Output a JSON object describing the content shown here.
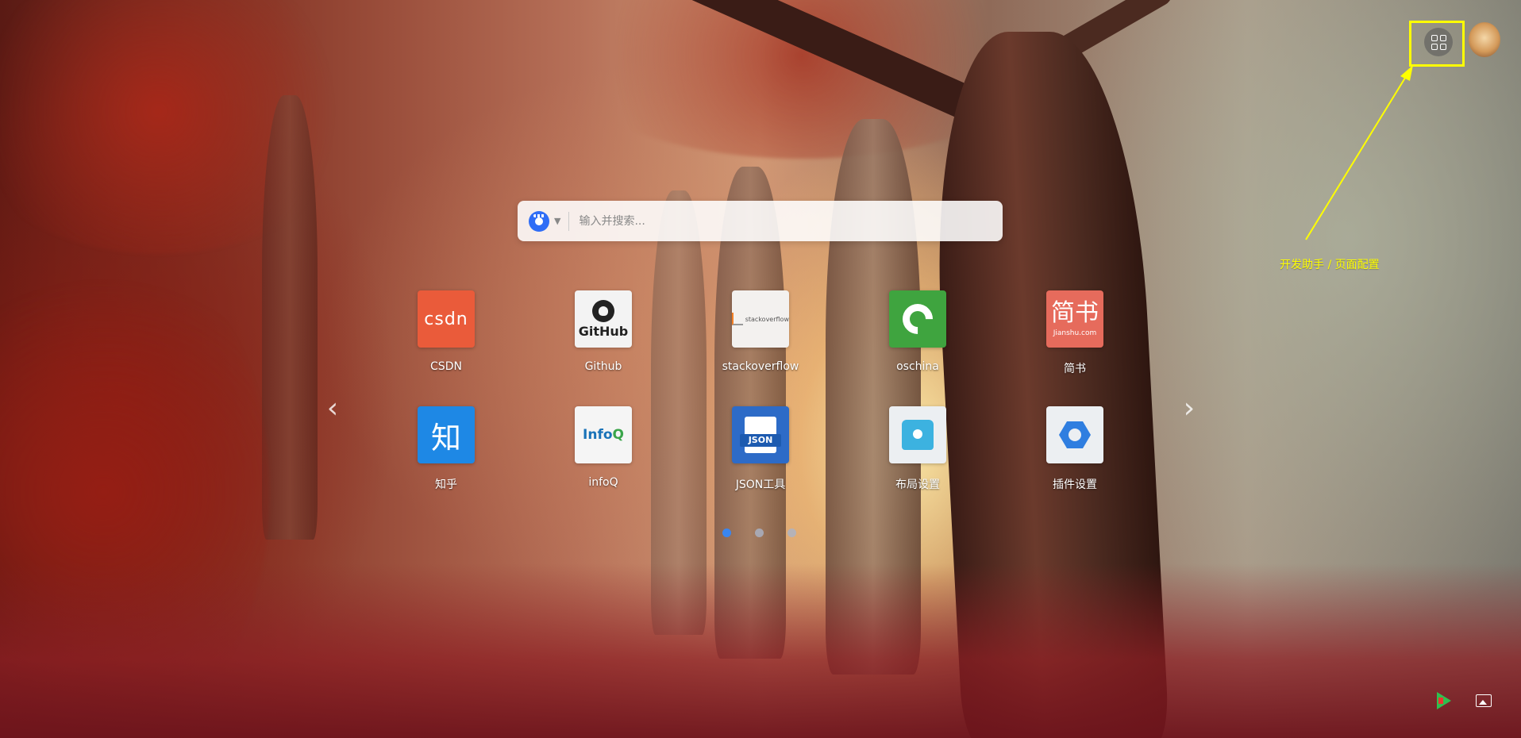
{
  "search": {
    "placeholder": "输入并搜索...",
    "engine_icon": "baidu-paw-icon"
  },
  "tiles": [
    {
      "label": "CSDN",
      "icon_text": "csdn",
      "color": "#ea5b3a"
    },
    {
      "label": "Github",
      "icon_text": "GitHub",
      "color": "#f3f3f3"
    },
    {
      "label": "stackoverflow",
      "icon_text": "stackoverflow",
      "color": "#f3f1ef"
    },
    {
      "label": "oschina",
      "icon_text": "",
      "color": "#3fa43f"
    },
    {
      "label": "简书",
      "icon_text": "简书",
      "icon_sub": "Jianshu.com",
      "color": "#e66b5c"
    },
    {
      "label": "知乎",
      "icon_text": "知",
      "color": "#1e88e5"
    },
    {
      "label": "infoQ",
      "icon_text": "Info",
      "icon_text_q": "Q",
      "color": "#f5f5f5"
    },
    {
      "label": "JSON工具",
      "icon_text": "JSON",
      "color": "#2d6bc7"
    },
    {
      "label": "布局设置",
      "icon_text": "",
      "color": "#eceff2"
    },
    {
      "label": "插件设置",
      "icon_text": "",
      "color": "#eceff2"
    }
  ],
  "nav": {
    "prev": "‹",
    "next": "›"
  },
  "pagination": {
    "count": 3,
    "active": 1,
    "active_color": "#3a86f0"
  },
  "annotation": {
    "text": "开发助手 / 页面配置",
    "color": "#ffff00"
  },
  "top_right": {
    "apps_icon": "apps-grid-icon",
    "avatar_icon": "user-avatar"
  },
  "bottom_right": {
    "store_icon": "app-store-icon",
    "wallpaper_icon": "wallpaper-icon"
  }
}
